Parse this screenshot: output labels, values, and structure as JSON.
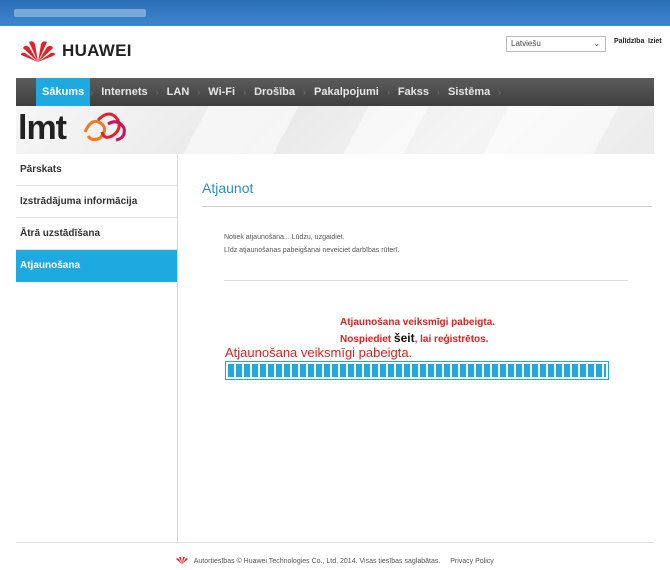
{
  "brand": {
    "name": "HUAWEI",
    "accent": "#1ea9e1",
    "logo_red": "#e4202b"
  },
  "header": {
    "language": "Latviešu",
    "help_link": "Palīdzība",
    "logout_link": "Iziet"
  },
  "nav": {
    "items": [
      {
        "label": "Sākums",
        "active": true
      },
      {
        "label": "Internets",
        "active": false
      },
      {
        "label": "LAN",
        "active": false
      },
      {
        "label": "Wi-Fi",
        "active": false
      },
      {
        "label": "Drošība",
        "active": false
      },
      {
        "label": "Pakalpojumi",
        "active": false
      },
      {
        "label": "Fakss",
        "active": false
      },
      {
        "label": "Sistēma",
        "active": false
      }
    ]
  },
  "banner": {
    "operator": "lmt"
  },
  "sidebar": {
    "items": [
      {
        "label": "Pārskats",
        "active": false
      },
      {
        "label": "Izstrādājuma informācija",
        "active": false
      },
      {
        "label": "Ātrā uzstādīšana",
        "active": false
      },
      {
        "label": "Atjaunošana",
        "active": true
      }
    ]
  },
  "main": {
    "title": "Atjaunot",
    "message_line1": "Notiek atjaunošana... Lūdzu, uzgaidiet.",
    "message_line2": "Līdz atjaunošanas pabeigšanai neveiciet darbības rūterī.",
    "success_line1": "Atjaunošana veiksmīgi pabeigta.",
    "success_line2_prefix": "Nospiediet ",
    "success_line2_link": "šeit",
    "success_line2_suffix": ", lai reģistrētos.",
    "success_line3": "Atjaunošana veiksmīgi pabeigta.",
    "progress_fraction": 1.0
  },
  "footer": {
    "copyright": "Autortiesības © Huawei Technologies Co., Ltd. 2014. Visas tiesības saglabātas.",
    "privacy_link": "Privacy Policy"
  }
}
